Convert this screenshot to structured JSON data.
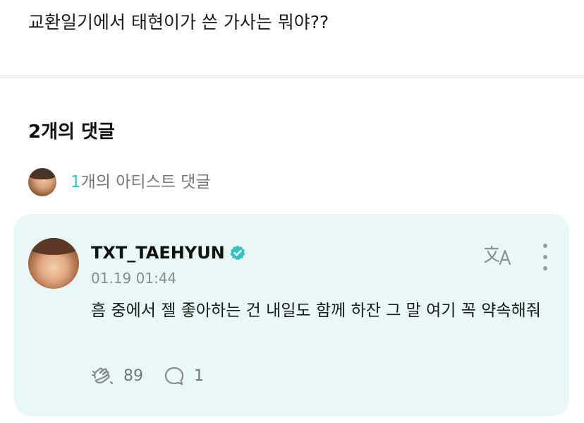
{
  "post": {
    "text": "교환일기에서 태현이가 쓴 가사는 뭐야??"
  },
  "comments": {
    "heading": "2개의 댓글",
    "artist_summary": {
      "count": "1",
      "label": "개의 아티스트 댓글"
    },
    "items": [
      {
        "username": "TXT_TAEHYUN",
        "verified": true,
        "timestamp": "01.19 01:44",
        "body": "흠 중에서 젤 좋아하는 건 내일도 함께 하잔 그 말 여기 꼭 약속해줘",
        "like_count": "89",
        "reply_count": "1"
      }
    ]
  },
  "colors": {
    "accent": "#33c2c2",
    "card_background": "#e8f8f6",
    "muted_text": "#777777"
  },
  "icons": {
    "verified": "verified-badge-icon",
    "translate": "translate-icon",
    "more": "more-vertical-icon",
    "cheer": "cheer-hands-icon",
    "reply": "comment-bubble-icon"
  }
}
